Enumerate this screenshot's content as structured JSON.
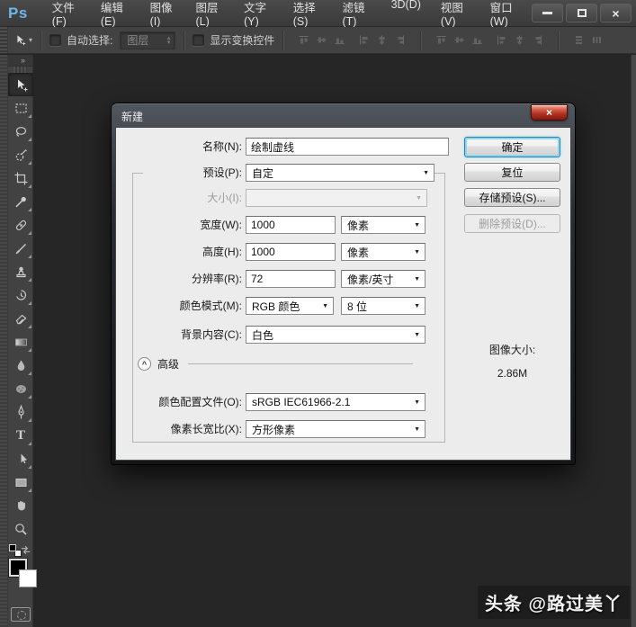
{
  "menu_bar": {
    "logo": "Ps",
    "items": [
      "文件(F)",
      "编辑(E)",
      "图像(I)",
      "图层(L)",
      "文字(Y)",
      "选择(S)",
      "滤镜(T)",
      "3D(D)",
      "视图(V)",
      "窗口(W)"
    ]
  },
  "options_bar": {
    "auto_select_label": "自动选择:",
    "auto_select_value": "图层",
    "show_transform_label": "显示变换控件",
    "align_icon_names": [
      "align-top-edges",
      "align-vertical-centers",
      "align-bottom-edges",
      "align-left-edges",
      "align-horizontal-centers",
      "align-right-edges",
      "distribute-top-edges",
      "distribute-vertical-centers",
      "distribute-bottom-edges",
      "distribute-left-edges",
      "distribute-horizontal-centers",
      "distribute-right-edges",
      "distribute-vertical-space",
      "distribute-horizontal-space"
    ]
  },
  "toolbar": {
    "tool_names": [
      "move",
      "rectangular-marquee",
      "lasso",
      "quick-selection",
      "crop",
      "eyedropper",
      "healing-brush",
      "brush",
      "clone-stamp",
      "history-brush",
      "eraser",
      "gradient",
      "blur",
      "sponge",
      "pen",
      "type",
      "path-selection",
      "rectangle-shape",
      "hand",
      "zoom"
    ],
    "selected_tool": "move"
  },
  "dialog": {
    "title": "新建",
    "name_label": "名称(N):",
    "name_value": "绘制虚线",
    "preset_label": "预设(P):",
    "preset_value": "自定",
    "size_label": "大小(I):",
    "size_value": "",
    "width_label": "宽度(W):",
    "width_value": "1000",
    "width_unit": "像素",
    "height_label": "高度(H):",
    "height_value": "1000",
    "height_unit": "像素",
    "resolution_label": "分辨率(R):",
    "resolution_value": "72",
    "resolution_unit": "像素/英寸",
    "color_mode_label": "颜色模式(M):",
    "color_mode_value": "RGB 颜色",
    "bit_depth_value": "8 位",
    "background_label": "背景内容(C):",
    "background_value": "白色",
    "advanced_label": "高级",
    "color_profile_label": "颜色配置文件(O):",
    "color_profile_value": "sRGB IEC61966-2.1",
    "pixel_aspect_label": "像素长宽比(X):",
    "pixel_aspect_value": "方形像素",
    "ok_button": "确定",
    "reset_button": "复位",
    "save_preset_button": "存储预设(S)...",
    "delete_preset_button": "删除预设(D)...",
    "image_size_label": "图像大小:",
    "image_size_value": "2.86M"
  },
  "icons": {
    "dropdown_arrow": "▼",
    "spinner_up": "▴",
    "spinner_down": "▾",
    "caret_down": "▾",
    "double_chevron": "»",
    "close": "×",
    "type_tool": "T",
    "advanced_chevron": "^"
  },
  "colors": {
    "ps_logo_blue": "#6fb7e8",
    "ok_focus_ring": "#8ed6ef",
    "close_button_red": "#ad3021",
    "dialog_bg": "#ececec",
    "app_canvas": "#262626"
  },
  "watermark": "头条 @路过美丫"
}
